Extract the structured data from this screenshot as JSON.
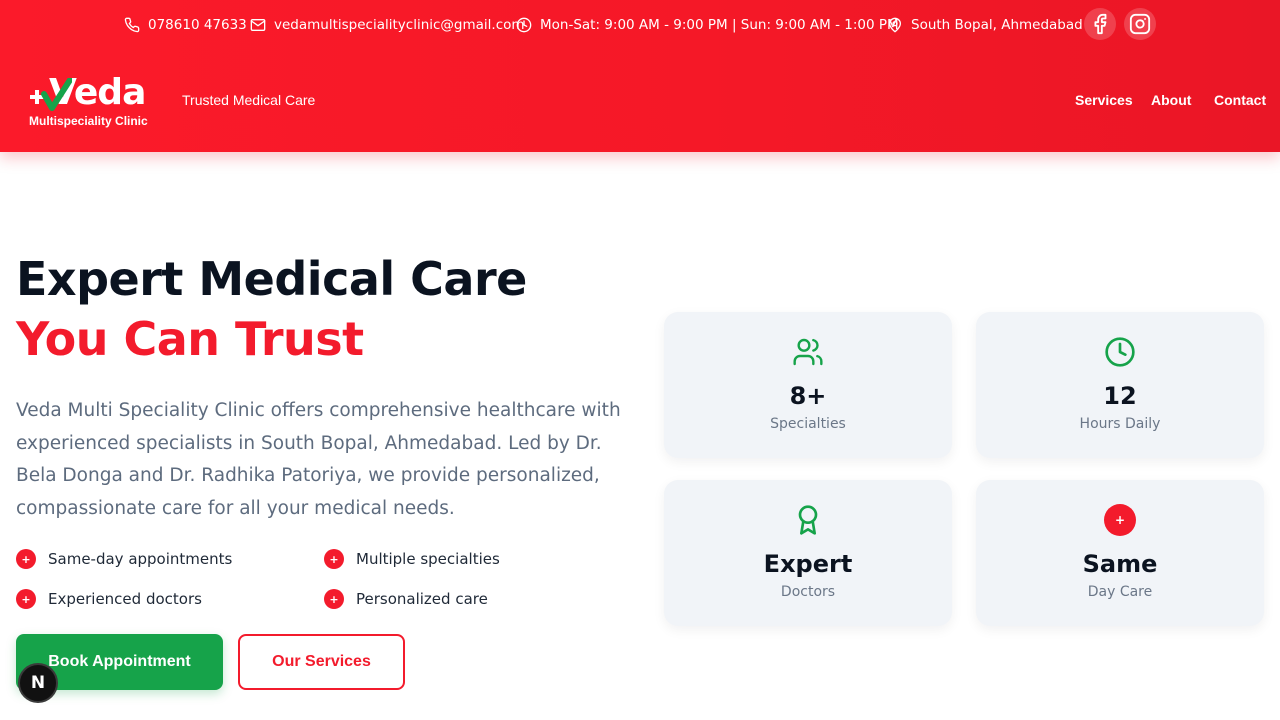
{
  "topbar": {
    "phone": "078610 47633",
    "email": "vedamultispecialityclinic@gmail.com",
    "hours": "Mon-Sat: 9:00 AM - 9:00 PM | Sun: 9:00 AM - 1:00 PM",
    "location": "South Bopal, Ahmedabad",
    "social": [
      "facebook-icon",
      "instagram-icon"
    ]
  },
  "brand": {
    "name": "Veda",
    "subtitle": "Multispeciality Clinic",
    "tagline": "Trusted Medical Care"
  },
  "nav": {
    "items": [
      "Services",
      "About",
      "Contact"
    ]
  },
  "hero": {
    "title_line1": "Expert Medical Care",
    "title_line2": "You Can Trust",
    "description": "Veda Multi Speciality Clinic offers comprehensive healthcare with experienced specialists in South Bopal, Ahmedabad. Led by Dr. Bela Donga and Dr. Radhika Patoriya, we provide personalized, compassionate care for all your medical needs.",
    "features": [
      "Same-day appointments",
      "Multiple specialties",
      "Experienced doctors",
      "Personalized care"
    ],
    "feature_marker": "+",
    "primary_cta": "Book Appointment",
    "secondary_cta": "Our Services"
  },
  "stats": [
    {
      "value": "8+",
      "label": "Specialties",
      "icon": "users-icon"
    },
    {
      "value": "12",
      "label": "Hours Daily",
      "icon": "clock-icon"
    },
    {
      "value": "Expert",
      "label": "Doctors",
      "icon": "award-icon"
    },
    {
      "value": "Same",
      "label": "Day Care",
      "icon": "plus-icon",
      "marker": "+"
    }
  ],
  "dev_badge": "N",
  "colors": {
    "brand_red": "#f31b2c",
    "accent_green": "#16a34a",
    "card_bg": "#f1f4f8",
    "text_muted": "#5d6b7e"
  }
}
